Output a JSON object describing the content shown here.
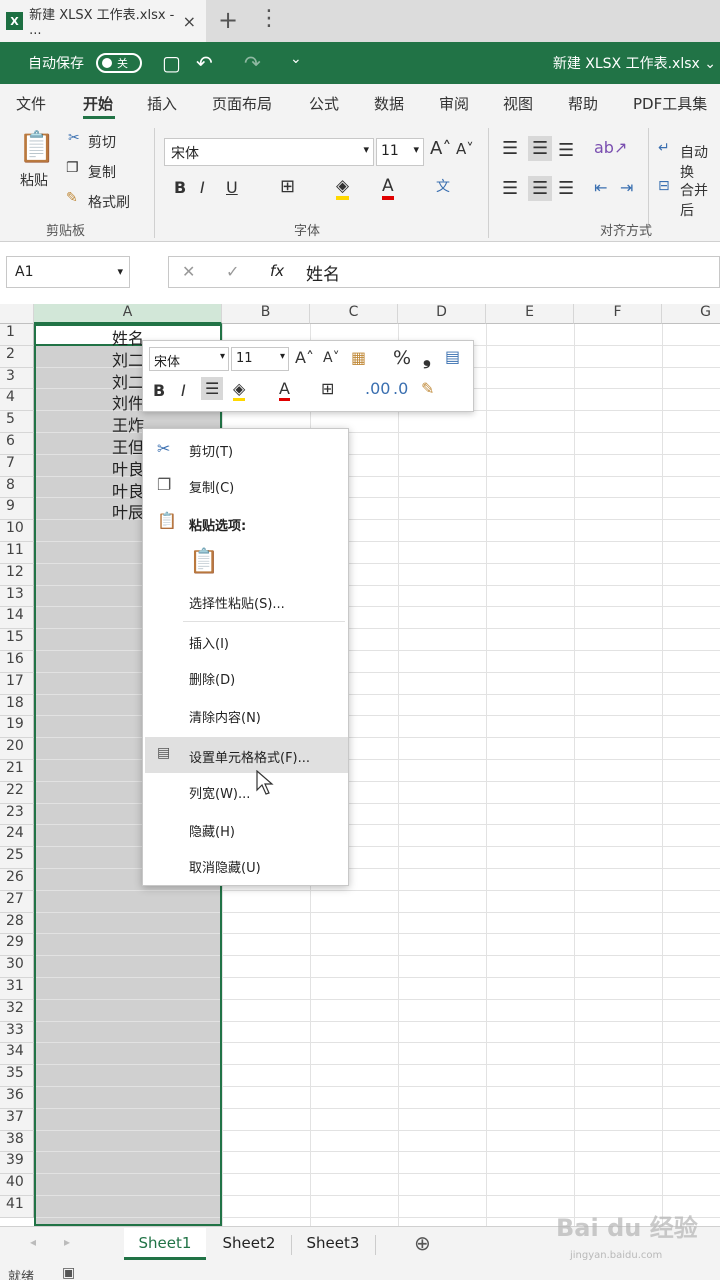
{
  "browser": {
    "tab_title": "新建 XLSX 工作表.xlsx - ...",
    "tab_close": "×",
    "new_tab": "+",
    "more": "⋮",
    "logo": "X"
  },
  "titlebar": {
    "autosave_label": "自动保存",
    "autosave_state": "关",
    "doc_title": "新建 XLSX 工作表.xlsx",
    "undo_icon": "↶",
    "redo_icon": "↷",
    "save_icon": "▢",
    "customize_icon": "⌄",
    "doc_chevron": "⌄"
  },
  "menu": [
    "文件",
    "开始",
    "插入",
    "页面布局",
    "公式",
    "数据",
    "审阅",
    "视图",
    "帮助",
    "PDF工具集"
  ],
  "ribbon": {
    "paste": "粘贴",
    "cut": "剪切",
    "copy": "复制",
    "format_painter": "格式刷",
    "clipboard_group": "剪贴板",
    "font_name": "宋体",
    "font_size": "11",
    "bold": "B",
    "italic": "I",
    "underline": "U",
    "font_group": "字体",
    "wrap_text": "自动换",
    "merge": "合并后",
    "align_group": "对齐方式"
  },
  "formula_bar": {
    "name_box": "A1",
    "fx": "fx",
    "content": "姓名"
  },
  "columns": [
    "A",
    "B",
    "C",
    "D",
    "E",
    "F",
    "G"
  ],
  "rows": [
    "1",
    "2",
    "3",
    "4",
    "5",
    "6",
    "7",
    "8",
    "9",
    "10",
    "11",
    "12",
    "13",
    "14",
    "15",
    "16",
    "17",
    "18",
    "19",
    "20",
    "21",
    "22",
    "23",
    "24",
    "25",
    "26",
    "27",
    "28",
    "29",
    "30",
    "31",
    "32",
    "33",
    "34",
    "35",
    "36",
    "37",
    "38",
    "39",
    "40",
    "41"
  ],
  "cells_a": [
    "姓名",
    "刘二",
    "刘二",
    "刘件",
    "王炸",
    "王但",
    "叶良",
    "叶良",
    "叶辰"
  ],
  "mini_toolbar": {
    "font": "宋体",
    "size": "11",
    "bold": "B",
    "italic": "I",
    "percent": "%",
    "comma": "❟"
  },
  "context_menu": {
    "cut": "剪切(T)",
    "copy": "复制(C)",
    "paste_options": "粘贴选项:",
    "paste_special": "选择性粘贴(S)...",
    "insert": "插入(I)",
    "delete": "删除(D)",
    "clear": "清除内容(N)",
    "format_cells": "设置单元格格式(F)...",
    "col_width": "列宽(W)...",
    "hide": "隐藏(H)",
    "unhide": "取消隐藏(U)"
  },
  "sheets": [
    "Sheet1",
    "Sheet2",
    "Sheet3"
  ],
  "status": {
    "ready": "就绪"
  },
  "watermark": {
    "brand": "Bai du 经验",
    "url": "jingyan.baidu.com"
  }
}
